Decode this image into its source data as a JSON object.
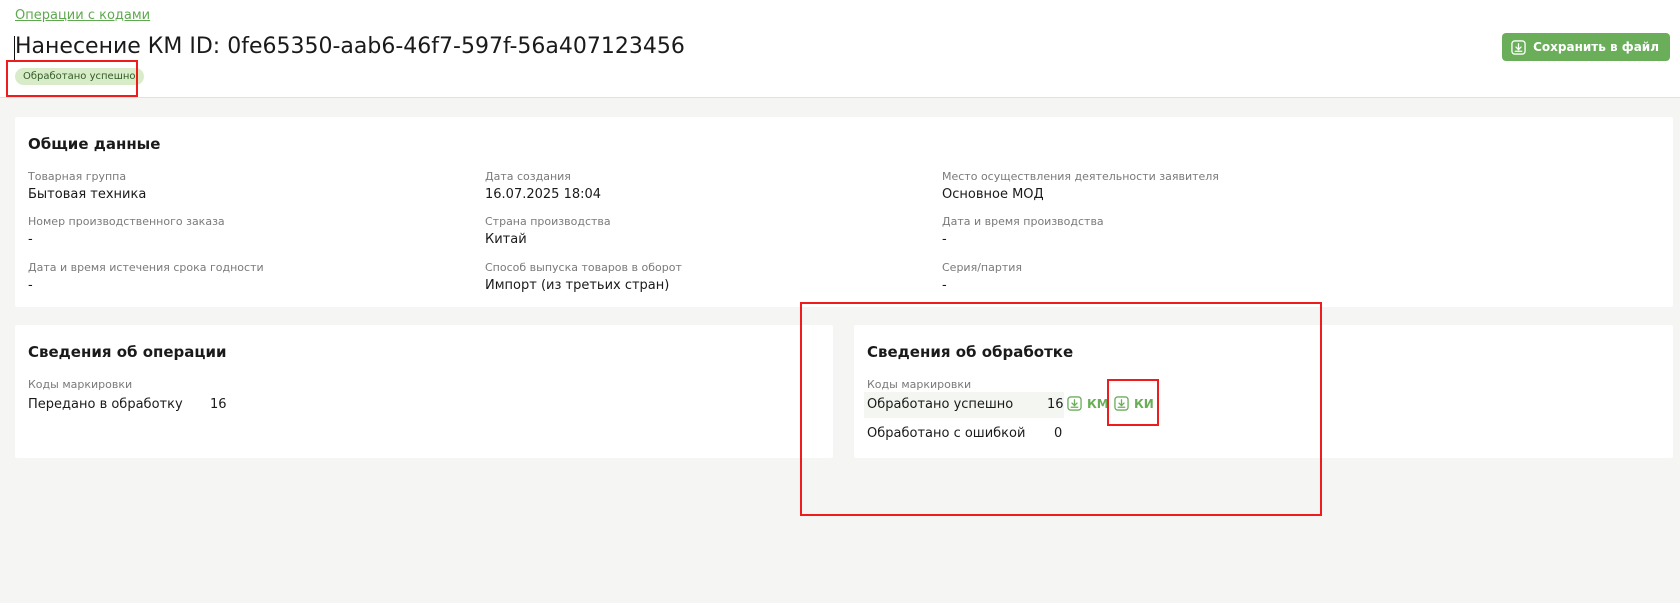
{
  "header": {
    "breadcrumb": "Операции с кодами",
    "title": "Нанесение КМ ID: 0fe65350-aab6-46f7-597f-56a407123456",
    "status_badge": "Обработано успешно",
    "save_button_label": "Сохранить в файл",
    "save_icon": "download-icon"
  },
  "general": {
    "title": "Общие данные",
    "fields": [
      {
        "label": "Товарная группа",
        "value": "Бытовая техника"
      },
      {
        "label": "Дата создания",
        "value": "16.07.2025 18:04"
      },
      {
        "label": "Место осуществления деятельности заявителя",
        "value": "Основное МОД"
      },
      {
        "label": "Номер производственного заказа",
        "value": "-"
      },
      {
        "label": "Страна производства",
        "value": "Китай"
      },
      {
        "label": "Дата и время производства",
        "value": "-"
      },
      {
        "label": "Дата и время истечения срока годности",
        "value": "-"
      },
      {
        "label": "Способ выпуска товаров в оборот",
        "value": "Импорт (из третьих стран)"
      },
      {
        "label": "Серия/партия",
        "value": "-"
      }
    ]
  },
  "operation": {
    "title": "Сведения об операции",
    "codes_label": "Коды маркировки",
    "rows": [
      {
        "label": "Передано в обработку",
        "value": "16"
      }
    ]
  },
  "processing": {
    "title": "Сведения об обработке",
    "codes_label": "Коды маркировки",
    "rows": [
      {
        "label": "Обработано успешно",
        "value": "16"
      },
      {
        "label": "Обработано с ошибкой",
        "value": "0"
      }
    ],
    "links": [
      {
        "label": "КМ",
        "icon": "download-icon"
      },
      {
        "label": "КИ",
        "icon": "download-icon"
      }
    ]
  },
  "colors": {
    "accent": "#6aae5a",
    "badge_bg": "#d9ecc9",
    "highlight_box": "#ee1c1c",
    "background": "#f5f5f3"
  }
}
